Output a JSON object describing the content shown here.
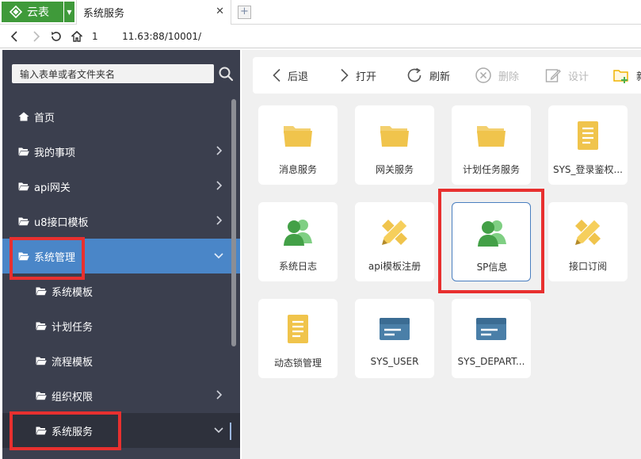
{
  "browser": {
    "app_name": "云表",
    "tab_title": "系统服务",
    "tab_close": "✕",
    "new_tab": "+",
    "url": "1        11.63:88/10001/"
  },
  "sidebar": {
    "search_placeholder": "输入表单或者文件夹名",
    "items": [
      {
        "label": "首页",
        "icon": "home-icon"
      },
      {
        "label": "我的事项",
        "icon": "folder-icon",
        "has_children": true
      },
      {
        "label": "api网关",
        "icon": "folder-icon",
        "has_children": true
      },
      {
        "label": "u8接口模板",
        "icon": "folder-icon",
        "has_children": true
      },
      {
        "label": "系统管理",
        "icon": "folder-open-icon",
        "expanded": true
      },
      {
        "label": "系统模板",
        "icon": "folder-icon"
      },
      {
        "label": "计划任务",
        "icon": "folder-icon"
      },
      {
        "label": "流程模板",
        "icon": "folder-icon"
      },
      {
        "label": "组织权限",
        "icon": "folder-icon",
        "has_children": true
      },
      {
        "label": "系统服务",
        "icon": "folder-icon",
        "expanded": true
      }
    ]
  },
  "toolbar": {
    "back": "后退",
    "open": "打开",
    "refresh": "刷新",
    "delete": "删除",
    "design": "设计",
    "new_folder": "新"
  },
  "tiles": [
    {
      "label": "消息服务",
      "icon": "folder-icon"
    },
    {
      "label": "网关服务",
      "icon": "folder-icon"
    },
    {
      "label": "计划任务服务",
      "icon": "folder-icon"
    },
    {
      "label": "SYS_登录鉴权...",
      "icon": "form-icon"
    },
    {
      "label": "系统日志",
      "icon": "users-icon"
    },
    {
      "label": "api模板注册",
      "icon": "pencil-icon"
    },
    {
      "label": "SP信息",
      "icon": "users-icon"
    },
    {
      "label": "接口订阅",
      "icon": "pencil-icon"
    },
    {
      "label": "动态锁管理",
      "icon": "form-icon"
    },
    {
      "label": "SYS_USER",
      "icon": "table-icon"
    },
    {
      "label": "SYS_DEPART...",
      "icon": "table-icon"
    }
  ],
  "colors": {
    "brand_green": "#3f9a3a",
    "sidebar_bg": "#3b3f4e",
    "active_blue": "#4a86c8",
    "highlight_red": "#e8302f",
    "folder_yellow": "#f0c44c",
    "user_green": "#4caf50",
    "table_blue": "#4a7fa8"
  }
}
